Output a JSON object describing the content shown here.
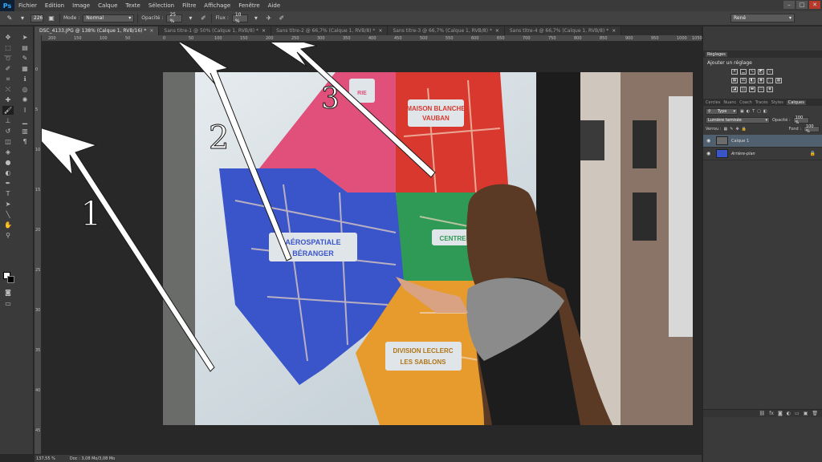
{
  "app": {
    "logo": "Ps"
  },
  "menu": [
    "Fichier",
    "Edition",
    "Image",
    "Calque",
    "Texte",
    "Sélection",
    "Filtre",
    "Affichage",
    "Fenêtre",
    "Aide"
  ],
  "window_buttons": [
    "–",
    "□",
    "✕"
  ],
  "options": {
    "brush_size": "226",
    "mode_label": "Mode :",
    "mode_value": "Normal",
    "opacity_label": "Opacité :",
    "opacity_value": "25 %",
    "flow_label": "Flux :",
    "flow_value": "10 %",
    "workspace": "René"
  },
  "tabs": [
    {
      "label": "DSC_4133.JPG @ 138% (Calque 1, RVB/16) *",
      "active": true
    },
    {
      "label": "Sans titre-1 @ 50% (Calque 1, RVB/8) *",
      "active": false
    },
    {
      "label": "Sans titre-2 @ 66,7% (Calque 1, RVB/8) *",
      "active": false
    },
    {
      "label": "Sans titre-3 @ 66,7% (Calque 1, RVB/8) *",
      "active": false
    },
    {
      "label": "Sans titre-4 @ 66,7% (Calque 1, RVB/8) *",
      "active": false
    }
  ],
  "ruler_top": [
    "200",
    "150",
    "100",
    "50",
    "0",
    "50",
    "100",
    "150",
    "200",
    "250",
    "300",
    "350",
    "400",
    "450",
    "500",
    "550",
    "600",
    "650",
    "700",
    "750",
    "800",
    "850",
    "900",
    "950",
    "1000",
    "1050"
  ],
  "ruler_left": [
    "0",
    "5",
    "10",
    "15",
    "20",
    "25",
    "30",
    "35",
    "40",
    "45"
  ],
  "image": {
    "districts": [
      "MAISON BLANCHE",
      "VAUBAN",
      "AÉROSPATIALE",
      "BÉRANGER",
      "CENTRE-V",
      "DIVISION LECLERC",
      "LES SABLONS",
      "RIE"
    ],
    "annotations": [
      "1",
      "2",
      "3"
    ]
  },
  "status": {
    "zoom": "137,55 %",
    "doc": "Doc : 3,08 Mo/3,08 Mo"
  },
  "adjustments": {
    "tabs": [
      "Réglages"
    ],
    "title": "Ajouter un réglage"
  },
  "layers_panel": {
    "tabs": [
      "Cercles",
      "Nuanc",
      "Coach",
      "Tracés",
      "Styles",
      "Calques"
    ],
    "kind_filter": "Type",
    "blend_mode": "Lumière tamisée",
    "opacity_label": "Opacité :",
    "opacity_value": "100 %",
    "lock_label": "Verrou :",
    "fill_label": "Fond :",
    "fill_value": "100 %",
    "layers": [
      {
        "name": "Calque 1",
        "selected": true
      },
      {
        "name": "Arrière-plan",
        "selected": false
      }
    ],
    "footer_icons": [
      "link-icon",
      "fx-icon",
      "mask-icon",
      "adjustment-icon",
      "folder-icon",
      "new-layer-icon",
      "trash-icon"
    ]
  },
  "colors": {
    "accent": "#31a8ff",
    "selected_layer": "#51606f",
    "map_red": "#d9382e",
    "map_pink": "#e0507a",
    "map_blue": "#3a55c9",
    "map_green": "#2f9a55",
    "map_orange": "#e79b2c"
  }
}
